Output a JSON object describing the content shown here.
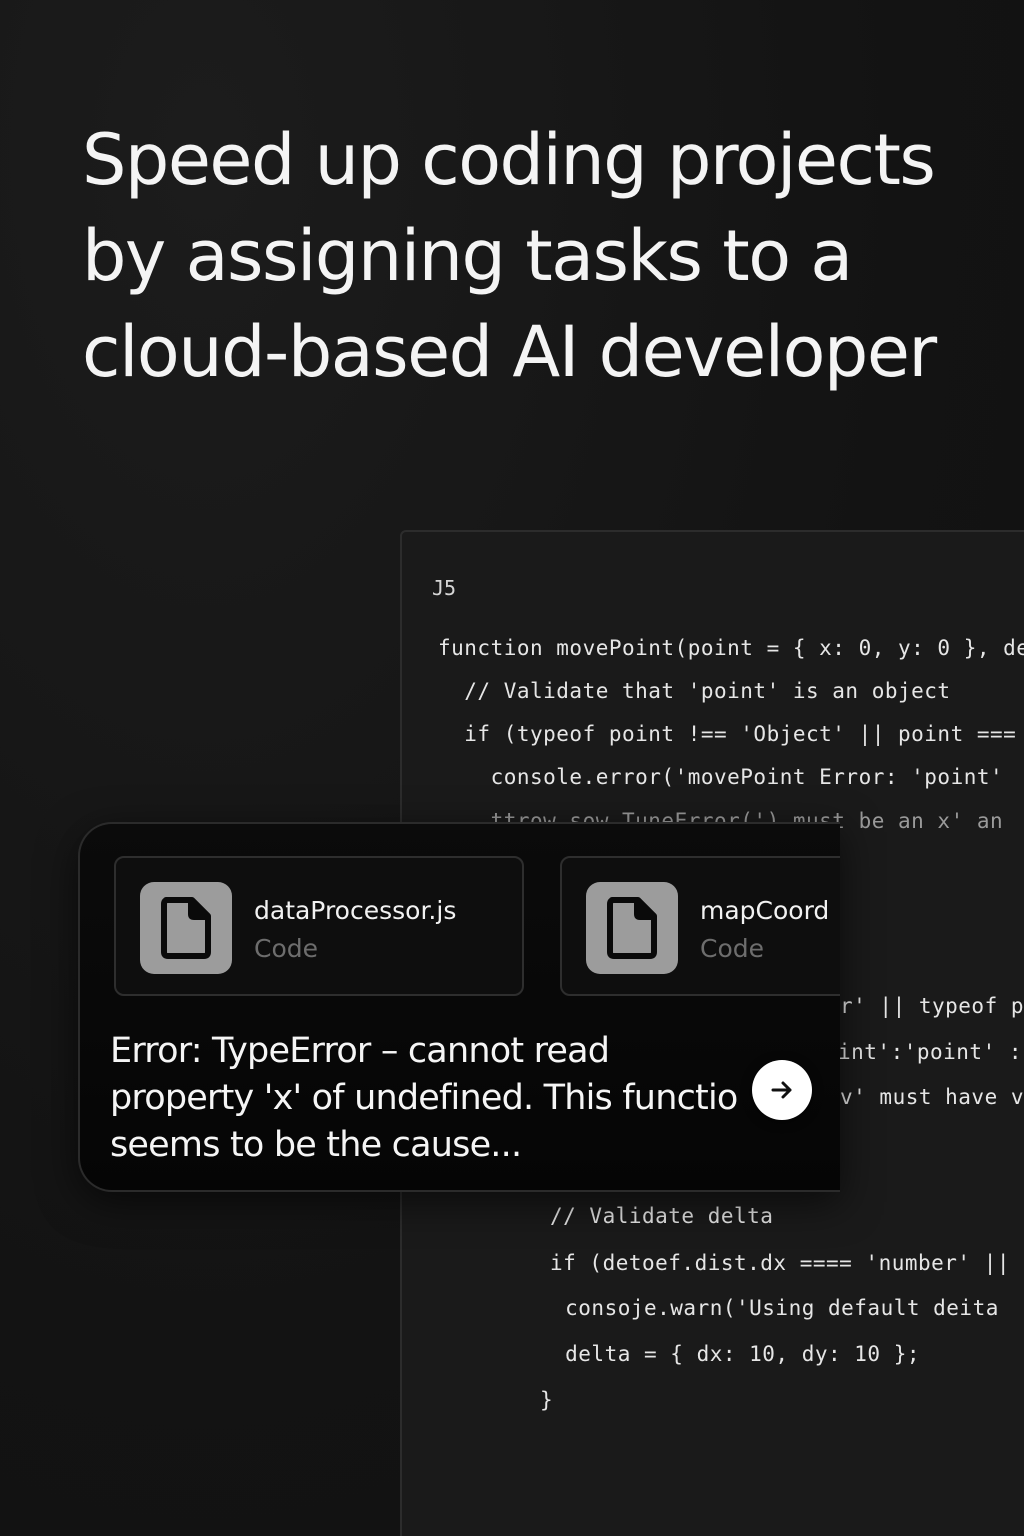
{
  "headline": {
    "line1": "Speed up coding projects",
    "line2": "by assigning tasks to a",
    "line3": "cloud-based AI developer"
  },
  "code_panel": {
    "language": "J5",
    "lines": [
      "function movePoint(point = { x: 0, y: 0 }, de",
      "  // Validate that 'point' is an object",
      "  if (typeof point !== 'Object' || point ===",
      "    console.error('movePoint Error: 'point'",
      "    ttrow sow TuneError(') must be an x' an",
      "r' || typeof p",
      "int':'point' :",
      "v' must have v",
      "// Validate delta",
      "if (detoef.dist.dx ==== 'number' ||",
      " consoje.warn('Using default deita",
      " delta = { dx: 10, dy: 10 };",
      "}"
    ]
  },
  "task_card": {
    "files": [
      {
        "name": "dataProcessor.js",
        "type": "Code",
        "icon": "file-icon"
      },
      {
        "name": "mapCoord",
        "type": "Code",
        "icon": "file-icon"
      }
    ],
    "message": {
      "line1": "Error: TypeError – cannot read",
      "line2": "property 'x' of undefined. This functio",
      "line3": "seems to be the cause..."
    },
    "send_icon": "arrow-right-icon"
  }
}
